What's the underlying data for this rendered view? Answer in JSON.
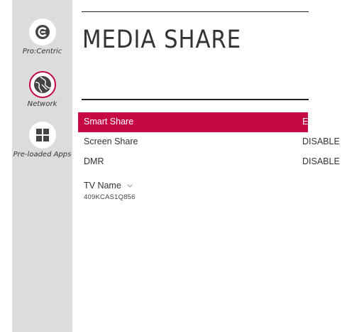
{
  "title": "MEDIA SHARE",
  "sidebar": {
    "items": [
      {
        "label": "Pro:Centric",
        "icon": "procentric-icon"
      },
      {
        "label": "Network",
        "icon": "globe-icon"
      },
      {
        "label": "Pre-loaded Apps",
        "icon": "grid-icon"
      }
    ]
  },
  "settings": [
    {
      "label": "Smart Share",
      "value": "ENABLE"
    },
    {
      "label": "Screen Share",
      "value": "DISABLE"
    },
    {
      "label": "DMR",
      "value": "DISABLE"
    }
  ],
  "tv_name": {
    "label": "TV Name",
    "value": "409KCAS1Q856"
  },
  "colors": {
    "accent": "#c60844",
    "sidebar": "#dcdcdc",
    "text": "#333333"
  }
}
